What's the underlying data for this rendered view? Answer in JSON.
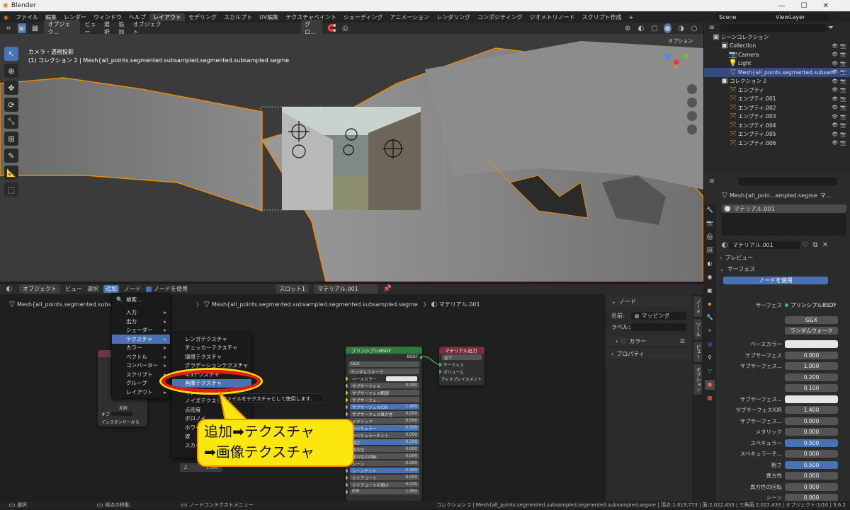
{
  "app": {
    "title": "Blender"
  },
  "colors": {
    "accent": "#4772b3",
    "selection_orange": "#f08a00",
    "callout_yellow": "#fbe70d",
    "highlight_red": "#e31b1b"
  },
  "menubar": {
    "items": [
      "ファイル",
      "編集",
      "レンダー",
      "ウィンドウ",
      "ヘルプ"
    ],
    "tabs": [
      "レイアウト",
      "モデリング",
      "スカルプト",
      "UV編集",
      "テクスチャペイント",
      "シェーディング",
      "アニメーション",
      "レンダリング",
      "コンポジティング",
      "ジオメトリノード",
      "スクリプト作成"
    ],
    "active_tab": "レイアウト",
    "plus": "+",
    "scene": "Scene",
    "view_layer": "ViewLayer"
  },
  "viewport": {
    "header": {
      "mode": "オブジェク...",
      "view": "ビュー",
      "select": "選択",
      "add": "追加",
      "object": "オブジェクト",
      "transform": "グロ...",
      "options": "オプション"
    },
    "overlay_line1": "カメラ・透視投影",
    "overlay_line2": "(1) コレクション 2 | Mesh{all_points.segmented.subsampled.segmented.subsampled.segme"
  },
  "outliner": {
    "title": "シーンコレクション",
    "search_placeholder": "",
    "items": [
      {
        "label": "Collection",
        "depth": 1
      },
      {
        "label": "Camera",
        "depth": 2
      },
      {
        "label": "Light",
        "depth": 2
      },
      {
        "label": "Mesh{all_points.segmented.subsam",
        "depth": 2,
        "selected": true
      },
      {
        "label": "コレクション 2",
        "depth": 1
      },
      {
        "label": "エンプティ",
        "depth": 2
      },
      {
        "label": "エンプティ.001",
        "depth": 2
      },
      {
        "label": "エンプティ.002",
        "depth": 2
      },
      {
        "label": "エンプティ.003",
        "depth": 2
      },
      {
        "label": "エンプティ.004",
        "depth": 2
      },
      {
        "label": "エンプティ.005",
        "depth": 2
      },
      {
        "label": "エンプティ.006",
        "depth": 2
      }
    ]
  },
  "properties": {
    "object_name": "Mesh{all_poin...ampled.segme",
    "object_suffix": "マ...",
    "material_slot": "マテリアル.001",
    "material_name": "マテリアル.001",
    "preview_label": "プレビュー",
    "surface_label": "サーフェス",
    "use_nodes": "ノードを使用",
    "surface_field_label": "サーフェス",
    "surface_shader": "プリンシプルBSDF",
    "distribution": "GGX",
    "subsurface_method": "ランダムウォーク",
    "rows": [
      {
        "label": "ベースカラー",
        "value": "",
        "kind": "white"
      },
      {
        "label": "サブサーフェス",
        "value": "0.000",
        "kind": "grey"
      },
      {
        "label": "サブサーフェス...",
        "value": "1.000",
        "kind": "grey"
      },
      {
        "label": "",
        "value": "0.200",
        "kind": "grey"
      },
      {
        "label": "",
        "value": "0.100",
        "kind": "grey"
      },
      {
        "label": "サブサーフェス...",
        "value": "",
        "kind": "white"
      },
      {
        "label": "サブサーフェスIOR",
        "value": "1.400",
        "kind": "grey"
      },
      {
        "label": "サブサーフェス...",
        "value": "0.000",
        "kind": "grey"
      },
      {
        "label": "メタリック",
        "value": "0.000",
        "kind": "grey"
      },
      {
        "label": "スペキュラー",
        "value": "0.500",
        "kind": "blue"
      },
      {
        "label": "スペキュラーチ...",
        "value": "0.000",
        "kind": "grey"
      },
      {
        "label": "粗さ",
        "value": "0.500",
        "kind": "blue"
      },
      {
        "label": "異方性",
        "value": "0.000",
        "kind": "grey"
      },
      {
        "label": "異方性の回転",
        "value": "0.000",
        "kind": "grey"
      },
      {
        "label": "シーン",
        "value": "0.000",
        "kind": "grey"
      }
    ]
  },
  "node_editor": {
    "header": {
      "mode": "オブジェクト",
      "view": "ビュー",
      "select": "選択",
      "add": "追加",
      "node": "ノード",
      "use_nodes": "ノードを使用",
      "slot": "スロット1",
      "material": "マテリアル.001"
    },
    "breadcrumb": {
      "object": "Mesh{all_points.segmented.subsampled.segmented.subsampled.segme",
      "object2": "Mesh{all_points.segmented.subsampled.segmented.subsampled.segme",
      "material": "マテリアル.001"
    },
    "add_menu": [
      "検索...",
      "入力",
      "出力",
      "シェーダー",
      "テクスチャ",
      "カラー",
      "ベクトル",
      "コンバーター",
      "スクリプト",
      "グループ",
      "レイアウト"
    ],
    "texture_menu": [
      "レンガテクスチャ",
      "チェッカーテクスチャ",
      "環境テクスチャ",
      "グラデーションテクスチャ",
      "IESテクスチャ",
      "画像テクスチャ",
      "マグレイブ",
      "ノイズテクスチャ",
      "点密度",
      "ボロノイ",
      "ホワイトノイズ",
      "波",
      "スカイ"
    ],
    "tooltip": "ファイルをテクスチャとして使用します.",
    "bsdf": {
      "title": "プリンシプルBSDF",
      "out": "BSDF",
      "dist": "GGX",
      "sss": "ランダムウォーク",
      "rows": [
        [
          "ベースカラー",
          ""
        ],
        [
          "サブサーフェス",
          "0.000"
        ],
        [
          "サブサーフェス範囲",
          ""
        ],
        [
          "サブサーフェ...",
          ""
        ],
        [
          "サブサーフェスIOR",
          "1.400"
        ],
        [
          "サブサーフェス異方性",
          "0.000"
        ],
        [
          "メタリック",
          "0.000"
        ],
        [
          "スペキュラー",
          "0.500"
        ],
        [
          "スペキュラーチント",
          "0.000"
        ],
        [
          "粗さ",
          "0.500"
        ],
        [
          "異方性",
          "0.000"
        ],
        [
          "異方性の回転",
          "0.000"
        ],
        [
          "シーン",
          "0.000"
        ],
        [
          "シーンチント",
          "0.500"
        ],
        [
          "クリアコート",
          "0.000"
        ],
        [
          "クリアコートの粗さ",
          "0.030"
        ],
        [
          "IOR",
          "1.450"
        ]
      ]
    },
    "output": {
      "title": "マテリアル出力",
      "target": "全て",
      "sockets": [
        "サーフェス",
        "ボリューム",
        "ディスプレイスメント"
      ]
    },
    "small_node": {
      "opt1": "反射",
      "opt2": "インスタンサーから",
      "label": "オブ"
    },
    "frame_value": "1.000",
    "frame_label": "Z"
  },
  "n_panel": {
    "title": "ノード",
    "name_label": "名前:",
    "name_value": "マッピング",
    "label_label": "ラベル:",
    "color": "カラー",
    "props": "プロパティ"
  },
  "vtabs": [
    "ノード",
    "ツール",
    "ビュー",
    "オプション"
  ],
  "callout": {
    "line1": "追加➡テクスチャ",
    "line2": "➡画像テクスチャ"
  },
  "status": {
    "left": "選択",
    "mid": "視点の移動",
    "right_menu": "ノードコンテクストメニュー",
    "info": "コレクション 2 | Mesh{all_points.segmented.subsampled.segmented.subsampled.segme | 頂点:1,019,773 | 面:2,022,433 | 三角面:2,022,433 | オブジェクト:1/10 | 3.6.2"
  }
}
